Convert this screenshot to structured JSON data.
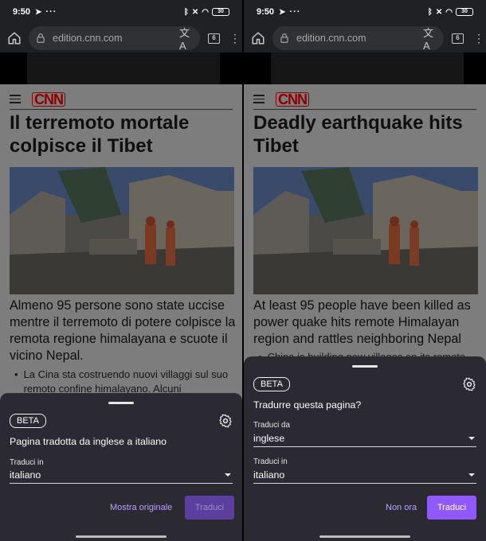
{
  "status": {
    "time": "9:50",
    "battery": "30"
  },
  "browser": {
    "url": "edition.cnn.com",
    "tab_count": "6"
  },
  "left": {
    "logo": "CNN",
    "headline": "Il terremoto mortale colpisce il Tibet",
    "subhead": "Almeno 95 persone sono state uccise mentre il terremoto di potere colpisce la remota regione himalayana e scuote il vicino Nepal.",
    "bullet": "La Cina sta costruendo nuovi villaggi sul suo remoto confine himalayano. Alcuni",
    "sheet": {
      "badge": "BETA",
      "title": "Pagina tradotta da inglese a italiano",
      "to_label": "Traduci in",
      "to_value": "italiano",
      "secondary_button": "Mostra originale",
      "primary_button": "Traduci"
    }
  },
  "right": {
    "logo": "CNN",
    "headline": "Deadly earthquake hits Tibet",
    "subhead": "At least 95 people have been killed as power quake hits remote Himalayan region and rattles neighboring Nepal",
    "bullet": "China is building new villages on its remote",
    "sheet": {
      "badge": "BETA",
      "title": "Tradurre questa pagina?",
      "from_label": "Traduci da",
      "from_value": "inglese",
      "to_label": "Traduci in",
      "to_value": "italiano",
      "secondary_button": "Non ora",
      "primary_button": "Traduci"
    }
  },
  "colors": {
    "accent": "#9059ff",
    "accent_disabled": "#5b3f9e",
    "sheet_bg": "#2b2a33",
    "link": "#b7a3ff"
  },
  "icons": [
    "home-icon",
    "lock-icon",
    "translate-icon",
    "tab-switcher-icon",
    "overflow-menu-icon",
    "hamburger-menu-icon",
    "settings-gear-icon",
    "dropdown-caret-icon",
    "telegram-icon",
    "bluetooth-icon",
    "wifi-icon",
    "battery-icon"
  ]
}
